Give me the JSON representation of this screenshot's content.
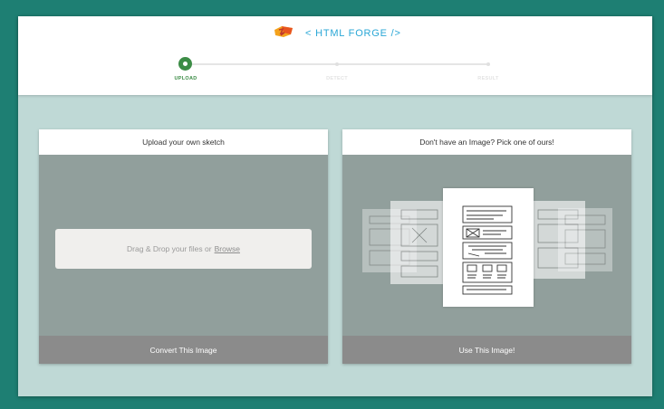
{
  "brand": {
    "title": "< HTML FORGE />",
    "logo_icon": "forge-logo-icon"
  },
  "stepper": {
    "steps": [
      {
        "label": "UPLOAD",
        "state": "active"
      },
      {
        "label": "DETECT",
        "state": "inactive"
      },
      {
        "label": "RESULT",
        "state": "inactive"
      }
    ]
  },
  "upload_card": {
    "title": "Upload your own sketch",
    "drop_text": "Drag & Drop your files or",
    "browse_label": "Browse",
    "button_label": "Convert This Image"
  },
  "sample_card": {
    "title": "Don't have an Image? Pick one of ours!",
    "button_label": "Use This Image!"
  },
  "colors": {
    "background": "#1e7f73",
    "accent_blue": "#2aa7d6",
    "accent_green": "#3c8c46"
  }
}
